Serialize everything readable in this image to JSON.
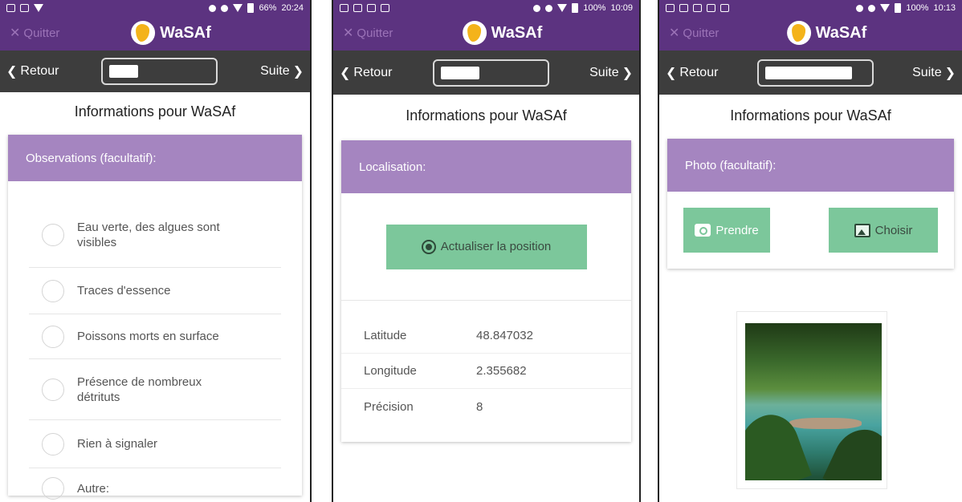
{
  "app": {
    "quit_label": "Quitter",
    "title": "WaSAf",
    "back_label": "Retour",
    "next_label": "Suite",
    "page_title": "Informations pour WaSAf"
  },
  "phone1": {
    "status": {
      "battery": "66%",
      "time": "20:24"
    },
    "section_title": "Observations (facultatif):",
    "options": [
      {
        "label": "Eau verte, des algues sont visibles"
      },
      {
        "label": "Traces d'essence"
      },
      {
        "label": "Poissons morts en surface"
      },
      {
        "label": "Présence de nombreux détrituts"
      },
      {
        "label": "Rien à signaler"
      },
      {
        "label": "Autre:"
      }
    ]
  },
  "phone2": {
    "status": {
      "battery": "100%",
      "time": "10:09"
    },
    "section_title": "Localisation:",
    "update_button": "Actualiser la position",
    "rows": [
      {
        "key": "Latitude",
        "value": "48.847032"
      },
      {
        "key": "Longitude",
        "value": "2.355682"
      },
      {
        "key": "Précision",
        "value": "8"
      }
    ]
  },
  "phone3": {
    "status": {
      "battery": "100%",
      "time": "10:13"
    },
    "section_title": "Photo (facultatif):",
    "take_button": "Prendre",
    "choose_button": "Choisir"
  },
  "colors": {
    "header_purple": "#5c3380",
    "section_purple": "#a585c0",
    "nav_dark": "#3d3d3d",
    "button_green": "#7cc79b"
  }
}
